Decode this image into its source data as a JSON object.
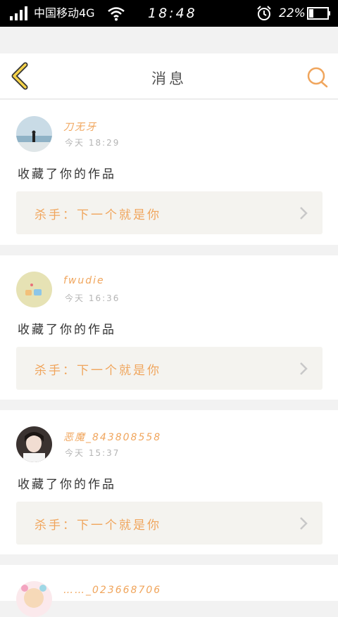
{
  "status_bar": {
    "carrier": "中国移动4G",
    "time": "18:48",
    "battery": "22%"
  },
  "header": {
    "title": "消息"
  },
  "messages": [
    {
      "username": "刀无牙",
      "time": "今天 18:29",
      "action": "收藏了你的作品",
      "work": "杀手：下一个就是你",
      "avatar": "beach-photo"
    },
    {
      "username": "fwudie",
      "time": "今天 16:36",
      "action": "收藏了你的作品",
      "work": "杀手：下一个就是你",
      "avatar": "cartoon-sticker"
    },
    {
      "username": "恶魔_843808558",
      "time": "今天 15:37",
      "action": "收藏了你的作品",
      "work": "杀手：下一个就是你",
      "avatar": "girl-portrait"
    },
    {
      "username": "……_023668706",
      "avatar": "anime-girl"
    }
  ],
  "colors": {
    "accent": "#f0a55c",
    "back_arrow": "#f5d24a",
    "status_bar": "#000000",
    "card_link_bg": "#f4f3ef"
  }
}
